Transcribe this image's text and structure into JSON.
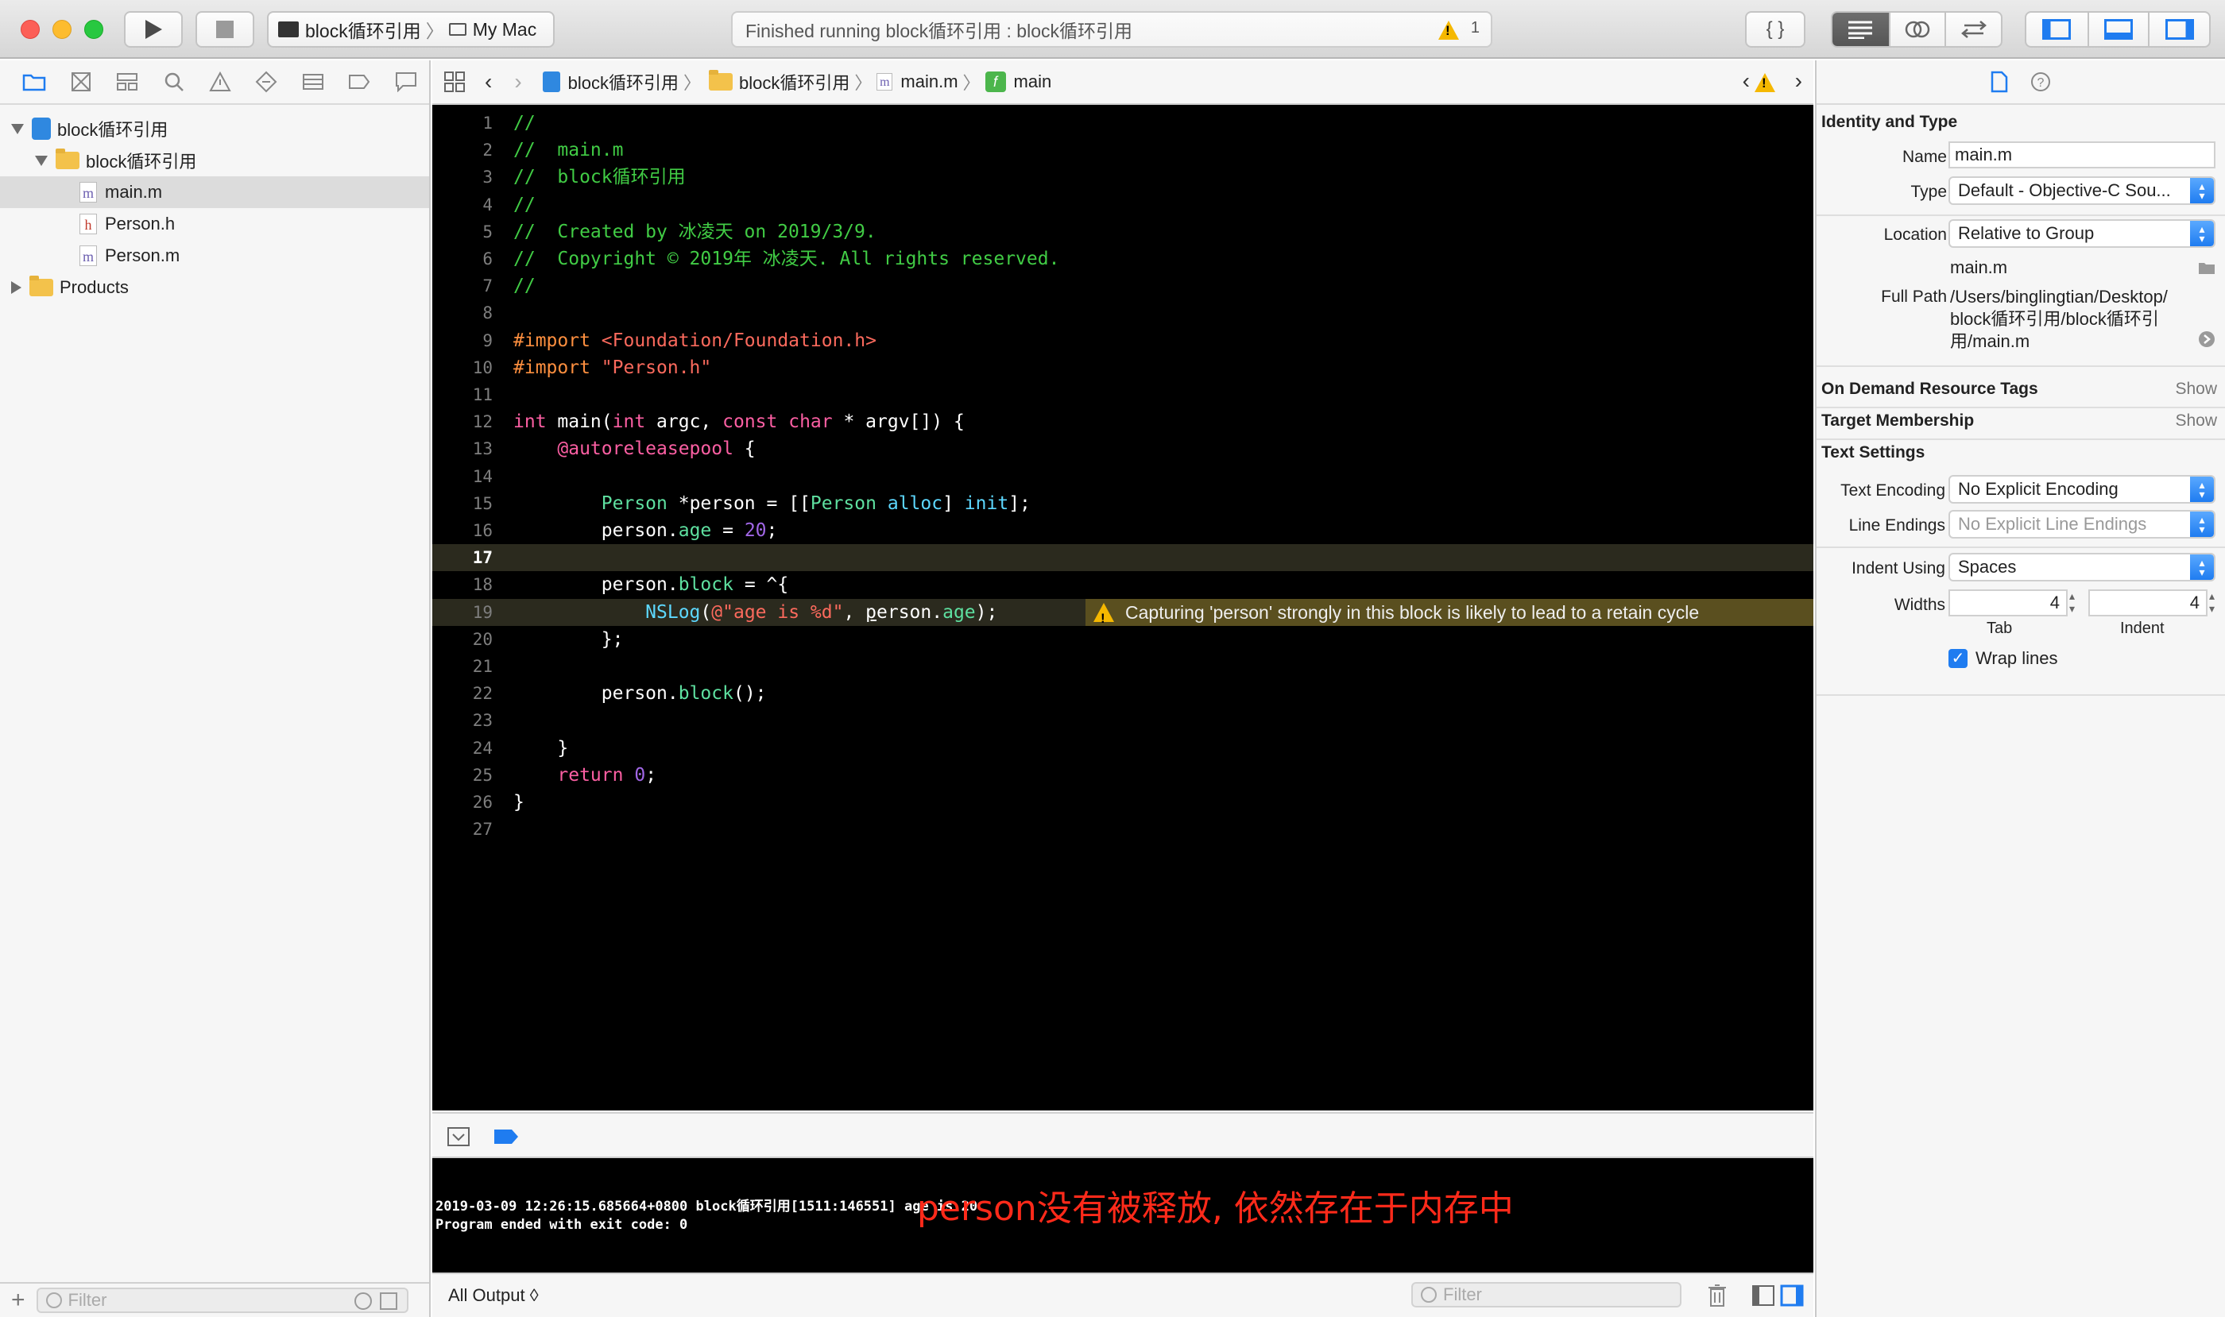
{
  "toolbar": {
    "scheme_target": "block循环引用",
    "destination": "My Mac",
    "status_text": "Finished running block循环引用 : block循环引用",
    "warning_count": "1",
    "braces_label": "{ }"
  },
  "navigator": {
    "tree": [
      {
        "label": "block循环引用",
        "kind": "project",
        "indent": 0,
        "disclosure": "open"
      },
      {
        "label": "block循环引用",
        "kind": "folder",
        "indent": 1,
        "disclosure": "open"
      },
      {
        "label": "main.m",
        "kind": "file",
        "icon_letter": "m",
        "indent": 2,
        "selected": true
      },
      {
        "label": "Person.h",
        "kind": "file",
        "icon_letter": "h",
        "indent": 2
      },
      {
        "label": "Person.m",
        "kind": "file",
        "icon_letter": "m",
        "indent": 2
      },
      {
        "label": "Products",
        "kind": "folder",
        "indent": 0,
        "disclosure": "closed"
      }
    ],
    "filter_placeholder": "Filter",
    "add_label": "+"
  },
  "jumpbar": {
    "crumbs": [
      "block循环引用",
      "block循环引用",
      "main.m",
      "main"
    ],
    "crumb_icons": [
      "project-icon",
      "folder-icon",
      "m-file-icon",
      "function-icon"
    ]
  },
  "editor": {
    "lines": [
      {
        "n": "1",
        "html": "<span class='cmt'>//</span>"
      },
      {
        "n": "2",
        "html": "<span class='cmt'>//  main.m</span>"
      },
      {
        "n": "3",
        "html": "<span class='cmt'>//  block循环引用</span>"
      },
      {
        "n": "4",
        "html": "<span class='cmt'>//</span>"
      },
      {
        "n": "5",
        "html": "<span class='cmt'>//  Created by 冰凌天 on 2019/3/9.</span>"
      },
      {
        "n": "6",
        "html": "<span class='cmt'>//  Copyright © 2019年 冰凌天. All rights reserved.</span>"
      },
      {
        "n": "7",
        "html": "<span class='cmt'>//</span>"
      },
      {
        "n": "8",
        "html": ""
      },
      {
        "n": "9",
        "html": "<span class='pp'>#import </span><span class='str'>&lt;Foundation/Foundation.h&gt;</span>"
      },
      {
        "n": "10",
        "html": "<span class='pp'>#import </span><span class='str'>\"Person.h\"</span>"
      },
      {
        "n": "11",
        "html": ""
      },
      {
        "n": "12",
        "html": "<span class='kw'>int</span> main(<span class='kw'>int</span> argc, <span class='kw'>const</span> <span class='kw'>char</span> * argv[]) {"
      },
      {
        "n": "13",
        "html": "    <span class='at'>@autoreleasepool</span> {"
      },
      {
        "n": "14",
        "html": ""
      },
      {
        "n": "15",
        "html": "        <span class='prop'>Person</span> *person = [[<span class='prop'>Person</span> <span class='ty'>alloc</span>] <span class='ty'>init</span>];"
      },
      {
        "n": "16",
        "html": "        person.<span class='prop'>age</span> = <span class='meth'>20</span>;"
      },
      {
        "n": "17",
        "html": "",
        "current": true
      },
      {
        "n": "18",
        "html": "        person.<span class='prop'>block</span> = ^{"
      },
      {
        "n": "19",
        "html": "            <span class='ty'>NSLog</span>(<span class='str'>@\"age is %d\"</span>, <u>p</u>erson.<span class='prop'>age</span>);",
        "warning": true
      },
      {
        "n": "20",
        "html": "        };"
      },
      {
        "n": "21",
        "html": ""
      },
      {
        "n": "22",
        "html": "        person.<span class='prop'>block</span>();"
      },
      {
        "n": "23",
        "html": ""
      },
      {
        "n": "24",
        "html": "    }"
      },
      {
        "n": "25",
        "html": "    <span class='kw'>return</span> <span class='meth'>0</span>;"
      },
      {
        "n": "26",
        "html": "}"
      },
      {
        "n": "27",
        "html": ""
      }
    ],
    "warning_message": "Capturing 'person' strongly in this block is likely to lead to a retain cycle"
  },
  "console": {
    "output": "2019-03-09 12:26:15.685664+0800 block循环引用[1511:146551] age is 20\nProgram ended with exit code: 0",
    "annotation": "person没有被释放, 依然存在于内存中",
    "output_selector": "All Output ◊",
    "filter_placeholder": "Filter"
  },
  "inspector": {
    "identity_header": "Identity and Type",
    "name_label": "Name",
    "name_value": "main.m",
    "type_label": "Type",
    "type_value": "Default - Objective-C Sou...",
    "location_label": "Location",
    "location_value": "Relative to Group",
    "location_file": "main.m",
    "fullpath_label": "Full Path",
    "fullpath_lines": [
      "/Users/binglingtian/Desktop/",
      "block循环引用/block循环引",
      "用/main.m"
    ],
    "ondemand_header": "On Demand Resource Tags",
    "target_header": "Target Membership",
    "show_label": "Show",
    "text_settings_header": "Text Settings",
    "encoding_label": "Text Encoding",
    "encoding_value": "No Explicit Encoding",
    "line_endings_label": "Line Endings",
    "line_endings_value": "No Explicit Line Endings",
    "indent_using_label": "Indent Using",
    "indent_using_value": "Spaces",
    "widths_label": "Widths",
    "tab_value": "4",
    "indent_value": "4",
    "tab_caption": "Tab",
    "indent_caption": "Indent",
    "wrap_label": "Wrap lines",
    "wrap_checked": true
  },
  "colors": {
    "accent": "#1f7cf0",
    "warning": "#f5b800",
    "annotation": "#ff2a1a",
    "editor_bg": "#000000"
  }
}
